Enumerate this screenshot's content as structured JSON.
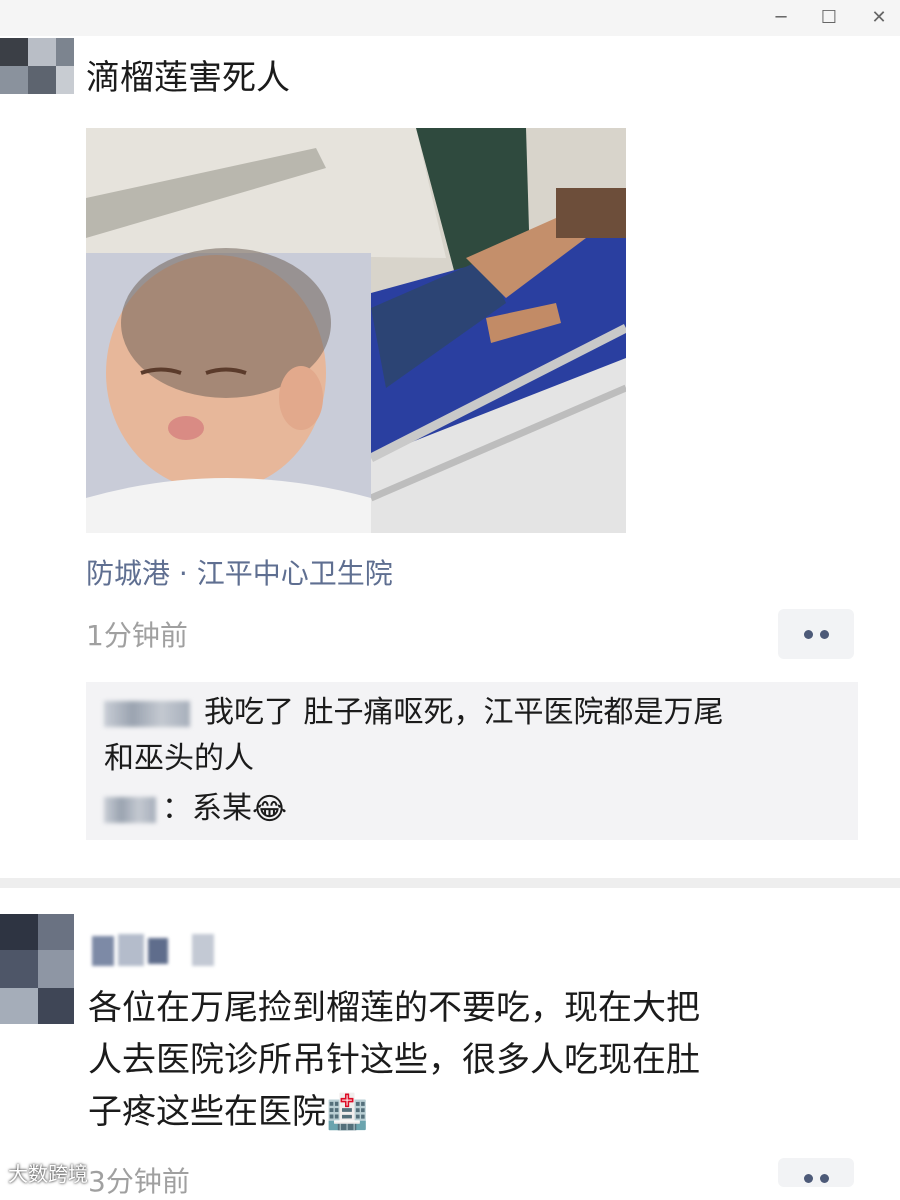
{
  "window": {
    "min_glyph": "─",
    "max_glyph": "☐",
    "close_glyph": "✕"
  },
  "post1": {
    "text": "滴榴莲害死人",
    "location": "防城港 · 江平中心卫生院",
    "time": "1分钟前",
    "comments": [
      {
        "text": "我吃了 肚子痛呕死，江平医院都是万尾"
      },
      {
        "text": "和巫头的人"
      },
      {
        "text": "：系某",
        "emoji": "😂"
      }
    ]
  },
  "post2": {
    "lines": [
      "各位在万尾捡到榴莲的不要吃，现在大把",
      "人去医院诊所吊针这些，很多人吃现在肚",
      "子疼这些在医院"
    ],
    "emoji": "🏥",
    "time": "3分钟前"
  },
  "watermark": "大数跨境"
}
